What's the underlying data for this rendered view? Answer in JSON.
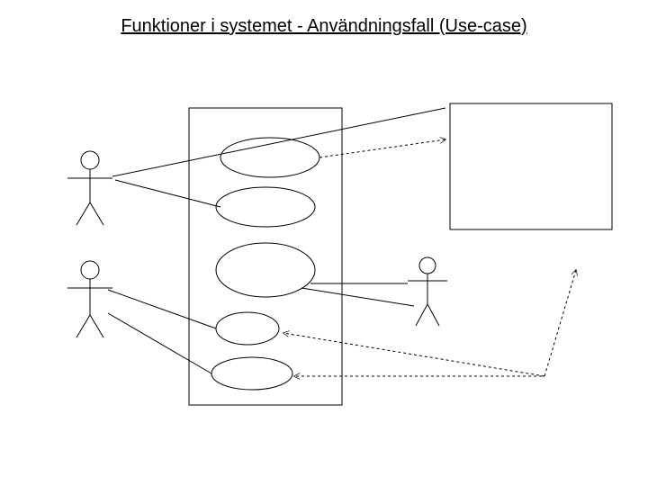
{
  "title": "Funktioner i systemet - Användningsfall (Use-case)",
  "notes": {
    "description": "UML-style use-case diagram with three stick-figure actors on left and lower-right, a system boundary box containing five use-case ellipses, an external system box on the right, and association lines (solid and dotted) connecting actors, use cases, and the external box.",
    "actor_count": 3,
    "use_case_count": 5,
    "external_boxes": 1
  }
}
